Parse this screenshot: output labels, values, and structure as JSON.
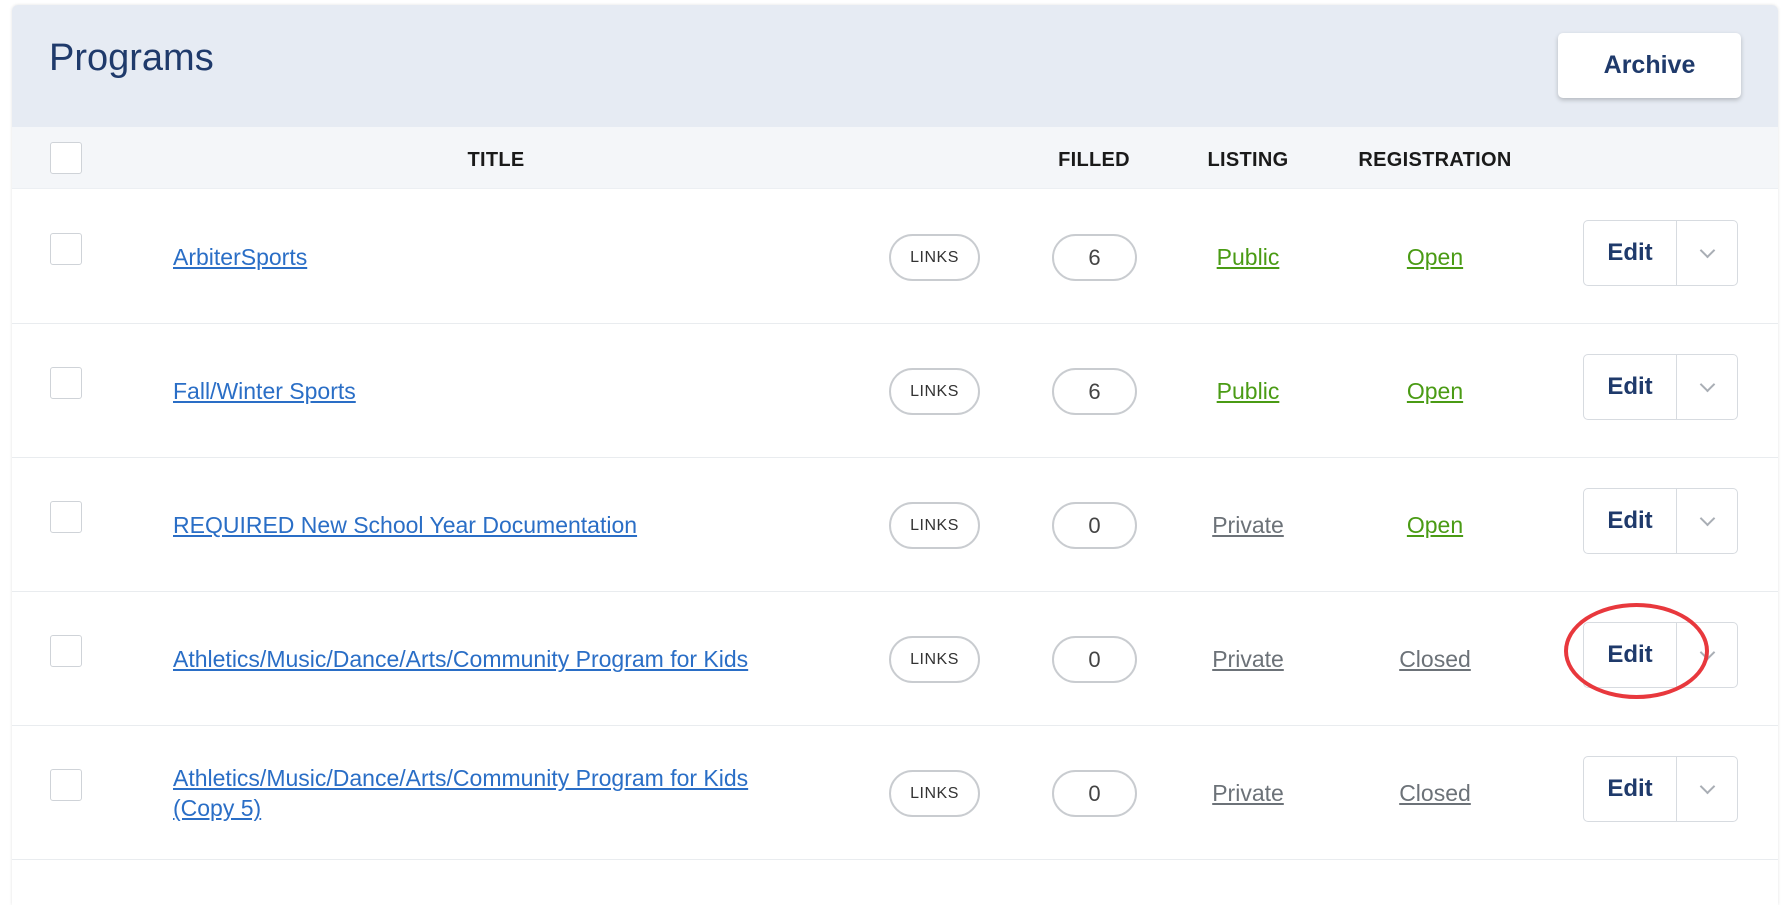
{
  "header": {
    "title": "Programs",
    "archive_label": "Archive"
  },
  "columns": {
    "title": "TITLE",
    "filled": "FILLED",
    "listing": "LISTING",
    "registration": "REGISTRATION"
  },
  "rows": [
    {
      "title": "ArbiterSports",
      "links_label": "LINKS",
      "filled": "6",
      "listing": "Public",
      "registration": "Open",
      "edit_label": "Edit"
    },
    {
      "title": "Fall/Winter Sports",
      "links_label": "LINKS",
      "filled": "6",
      "listing": "Public",
      "registration": "Open",
      "edit_label": "Edit"
    },
    {
      "title": "REQUIRED New School Year Documentation",
      "links_label": "LINKS",
      "filled": "0",
      "listing": "Private",
      "registration": "Open",
      "edit_label": "Edit"
    },
    {
      "title": "Athletics/Music/Dance/Arts/Community Program for Kids",
      "links_label": "LINKS",
      "filled": "0",
      "listing": "Private",
      "registration": "Closed",
      "edit_label": "Edit"
    },
    {
      "title": "Athletics/Music/Dance/Arts/Community Program for Kids (Copy 5)",
      "links_label": "LINKS",
      "filled": "0",
      "listing": "Private",
      "registration": "Closed",
      "edit_label": "Edit"
    }
  ],
  "colors": {
    "link": "#2a6ec6",
    "public_open": "#4a9b14",
    "private_closed": "#6c7278",
    "navy": "#1f3a6b",
    "highlight": "#e8383d"
  },
  "icons": {
    "dropdown": "chevron-down-icon"
  }
}
